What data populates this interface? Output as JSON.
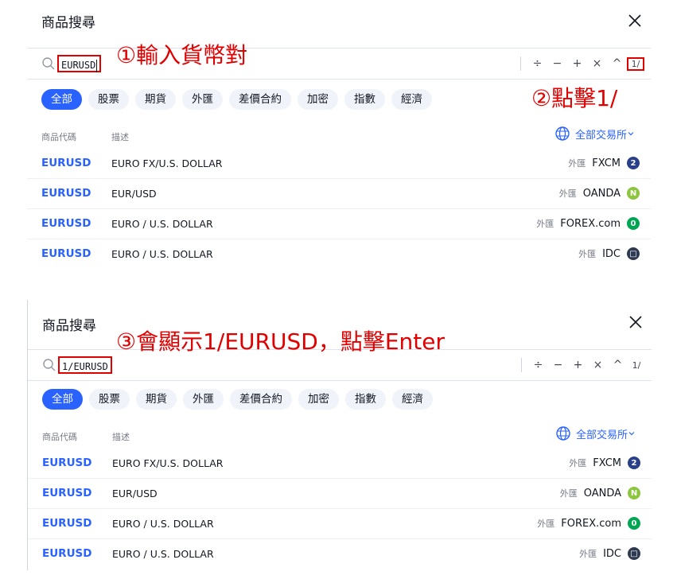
{
  "panel1": {
    "title": "商品搜尋",
    "search_value": "EURUSD",
    "ops": [
      "÷",
      "−",
      "+",
      "×",
      "^",
      "1/"
    ],
    "chips": [
      "全部",
      "股票",
      "期貨",
      "外匯",
      "差價合約",
      "加密",
      "指數",
      "經濟"
    ],
    "col_symbol": "商品代碼",
    "col_desc": "描述",
    "exchange_filter": "全部交易所",
    "rows": [
      {
        "symbol": "EURUSD",
        "desc": "EURO FX/U.S. DOLLAR",
        "cat": "外匯",
        "exchange": "FXCM",
        "icon_color": "#2a3f8a",
        "icon": "2"
      },
      {
        "symbol": "EURUSD",
        "desc": "EUR/USD",
        "cat": "外匯",
        "exchange": "OANDA",
        "icon_color": "#8cc63f",
        "icon": "N"
      },
      {
        "symbol": "EURUSD",
        "desc": "EURO / U.S. DOLLAR",
        "cat": "外匯",
        "exchange": "FOREX.com",
        "icon_color": "#00a651",
        "icon": "0"
      },
      {
        "symbol": "EURUSD",
        "desc": "EURO / U.S. DOLLAR",
        "cat": "外匯",
        "exchange": "IDC",
        "icon_color": "#2e3a52",
        "icon": "□"
      }
    ]
  },
  "panel2": {
    "title": "商品搜尋",
    "search_value": "1/EURUSD",
    "ops": [
      "÷",
      "−",
      "+",
      "×",
      "^",
      "1/"
    ],
    "chips": [
      "全部",
      "股票",
      "期貨",
      "外匯",
      "差價合約",
      "加密",
      "指數",
      "經濟"
    ],
    "col_symbol": "商品代碼",
    "col_desc": "描述",
    "exchange_filter": "全部交易所",
    "rows": [
      {
        "symbol": "EURUSD",
        "desc": "EURO FX/U.S. DOLLAR",
        "cat": "外匯",
        "exchange": "FXCM",
        "icon_color": "#2a3f8a",
        "icon": "2"
      },
      {
        "symbol": "EURUSD",
        "desc": "EUR/USD",
        "cat": "外匯",
        "exchange": "OANDA",
        "icon_color": "#8cc63f",
        "icon": "N"
      },
      {
        "symbol": "EURUSD",
        "desc": "EURO / U.S. DOLLAR",
        "cat": "外匯",
        "exchange": "FOREX.com",
        "icon_color": "#00a651",
        "icon": "0"
      },
      {
        "symbol": "EURUSD",
        "desc": "EURO / U.S. DOLLAR",
        "cat": "外匯",
        "exchange": "IDC",
        "icon_color": "#2e3a52",
        "icon": "□"
      }
    ]
  },
  "annotations": {
    "step1": "①輸入貨幣對",
    "step2": "②點擊1/",
    "step3": "③會顯示1/EURUSD，點擊Enter"
  },
  "colors": {
    "accent": "#2962ff",
    "annotation": "#e00000"
  }
}
